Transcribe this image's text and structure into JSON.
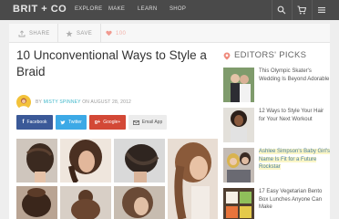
{
  "brand": {
    "name": "BRIT + CO",
    "accent": "#e8e8e8"
  },
  "nav": {
    "items": [
      "EXPLORE",
      "MAKE",
      "LEARN",
      "SHOP"
    ],
    "icons": [
      "search-icon",
      "cart-icon",
      "menu-icon"
    ]
  },
  "sharebar": {
    "share_label": "SHARE",
    "save_label": "SAVE",
    "likes": "100"
  },
  "article": {
    "title": "10 Unconventional Ways to Style a Braid",
    "by_label": "BY",
    "author": "MISTY SPINNEY",
    "date_text": "ON AUGUST 28, 2012",
    "buttons": [
      {
        "label": "Facebook",
        "color": "#3b5998"
      },
      {
        "label": "Twitter",
        "color": "#3ca9e6"
      },
      {
        "label": "Google+",
        "color": "#d34836"
      },
      {
        "label": "Email App",
        "color": "#ececec"
      }
    ]
  },
  "sidebar": {
    "heading": "EDITORS' PICKS",
    "items": [
      {
        "text": "This Olympic Skater's Wedding Is Beyond Adorable"
      },
      {
        "text": "12 Ways to Style Your Hair for Your Next Workout"
      },
      {
        "text": "Ashlee Simpson's Baby Girl's Name Is Fit for a Future Rockstar"
      },
      {
        "text": "17 Easy Vegetarian Bento Box Lunches Anyone Can Make"
      }
    ]
  }
}
